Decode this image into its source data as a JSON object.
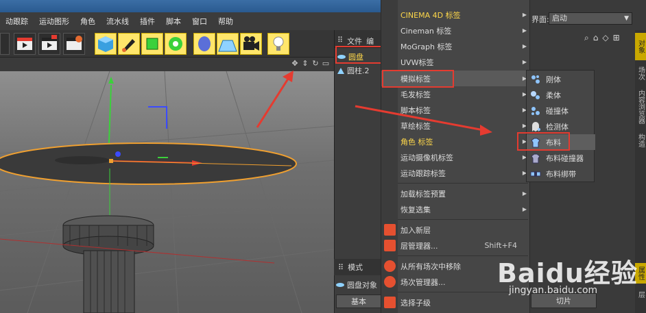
{
  "menubar": {
    "items": [
      "动跟踪",
      "运动图形",
      "角色",
      "流水线",
      "插件",
      "脚本",
      "窗口",
      "帮助"
    ]
  },
  "layout": {
    "label": "界面:",
    "value": "启动"
  },
  "object_panel": {
    "tabs": [
      "文件",
      "编"
    ],
    "objects": [
      {
        "name": "圆盘"
      },
      {
        "name": "圆柱.2"
      }
    ]
  },
  "attr_panel": {
    "tab": "模式",
    "object_label": "圆盘对象",
    "basic_button": "基本"
  },
  "context_menu": {
    "items": [
      {
        "label": "CINEMA 4D 标签",
        "highlight": true,
        "submenu": true
      },
      {
        "label": "Cineman 标签",
        "highlight": false,
        "submenu": true
      },
      {
        "label": "MoGraph 标签",
        "highlight": false,
        "submenu": true
      },
      {
        "label": "UVW标签",
        "highlight": false,
        "submenu": true
      },
      {
        "label": "模拟标签",
        "highlight": false,
        "submenu": true,
        "selected": true
      },
      {
        "label": "毛发标签",
        "highlight": false,
        "submenu": true
      },
      {
        "label": "脚本标签",
        "highlight": false,
        "submenu": true
      },
      {
        "label": "草绘标签",
        "highlight": false,
        "submenu": true
      },
      {
        "label": "角色 标签",
        "highlight": true,
        "submenu": true
      },
      {
        "label": "运动摄像机标签",
        "highlight": false,
        "submenu": true
      },
      {
        "label": "运动跟踪标签",
        "highlight": false,
        "submenu": true
      }
    ],
    "items2": [
      {
        "label": "加载标签预置",
        "submenu": true
      },
      {
        "label": "恢复选集",
        "submenu": true
      }
    ],
    "items3": [
      {
        "label": "加入新层",
        "shortcut": ""
      },
      {
        "label": "层管理器...",
        "shortcut": "Shift+F4"
      }
    ],
    "items4": [
      {
        "label": "从所有场次中移除"
      },
      {
        "label": "场次管理器..."
      }
    ],
    "items5": [
      {
        "label": "选择子级"
      }
    ]
  },
  "submenu": {
    "items": [
      {
        "label": "刚体"
      },
      {
        "label": "柔体"
      },
      {
        "label": "碰撞体"
      },
      {
        "label": "检测体"
      },
      {
        "label": "布料",
        "selected": true
      },
      {
        "label": "布料碰撞器"
      },
      {
        "label": "布料绑带"
      }
    ]
  },
  "side_tabs": [
    "对象",
    "场次",
    "内容浏览器",
    "构造",
    "属性",
    "层"
  ],
  "cut_button": "切片",
  "watermark": {
    "brand": "Baidu经验",
    "url": "jingyan.baidu.com"
  },
  "colors": {
    "highlight_yellow": "#ffd84a",
    "annotation_red": "#e53b30",
    "axis_green": "#3bd13b",
    "axis_red": "#e53b30",
    "axis_blue": "#3b4bff",
    "selection_orange": "#f0a030"
  }
}
